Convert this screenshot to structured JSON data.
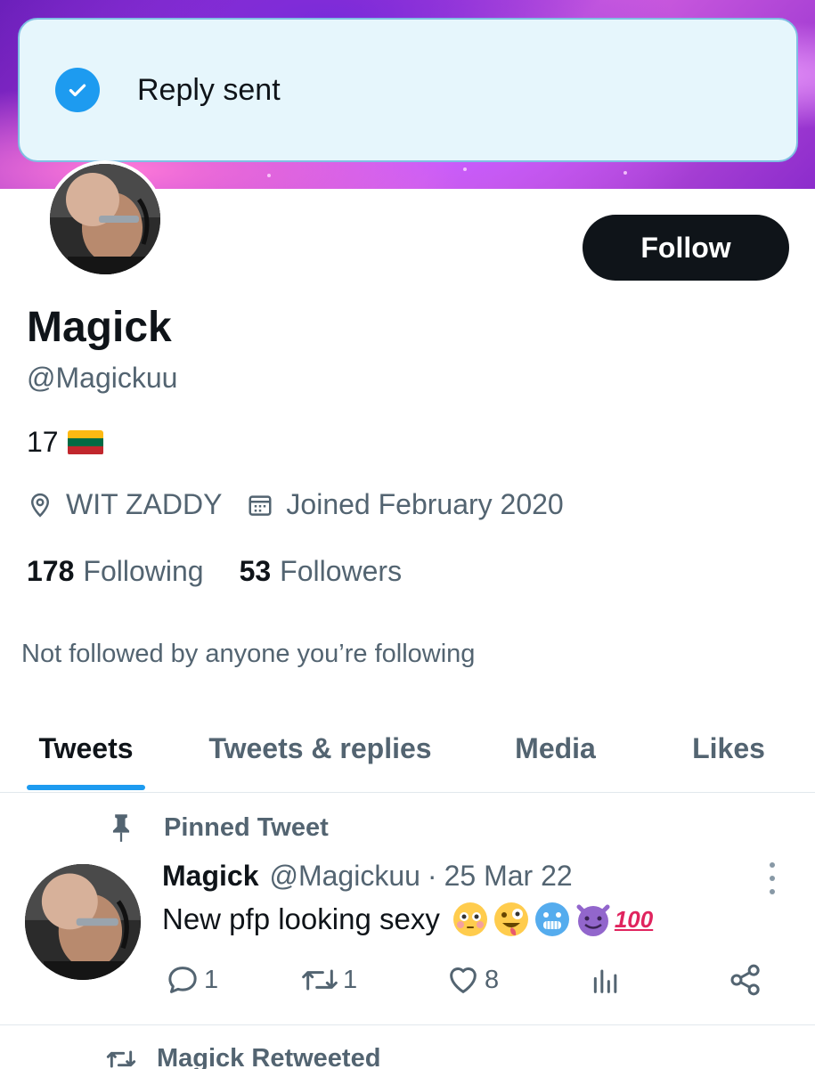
{
  "toast": {
    "message": "Reply sent",
    "icon": "check-circle-icon",
    "accent": "#1d9bf0"
  },
  "profile": {
    "display_name": "Magick",
    "handle": "@Magickuu",
    "bio": "17",
    "bio_flag": "lithuania-flag",
    "location": "WIT ZADDY",
    "joined": "Joined February 2020",
    "follow_label": "Follow",
    "following_count": "178",
    "following_label": "Following",
    "followers_count": "53",
    "followers_label": "Followers",
    "mutuals_note": "Not followed by anyone you’re following"
  },
  "tabs": [
    {
      "label": "Tweets",
      "active": true
    },
    {
      "label": "Tweets & replies",
      "active": false
    },
    {
      "label": "Media",
      "active": false
    },
    {
      "label": "Likes",
      "active": false
    }
  ],
  "pinned_tweet": {
    "pinned_label": "Pinned Tweet",
    "author_name": "Magick",
    "author_handle": "@Magickuu",
    "separator": "·",
    "date": "25 Mar 22",
    "text": "New pfp looking sexy",
    "emojis": [
      "flushed-face",
      "zany-face",
      "cold-face",
      "smiling-imp",
      "hundred-points"
    ],
    "hundred_text": "100",
    "replies": "1",
    "retweets": "1",
    "likes": "8"
  },
  "next_item": {
    "label": "Magick Retweeted"
  },
  "colors": {
    "accent": "#1d9bf0",
    "text": "#0f1419",
    "muted": "#536471",
    "toast_bg": "#e6f6fc"
  }
}
